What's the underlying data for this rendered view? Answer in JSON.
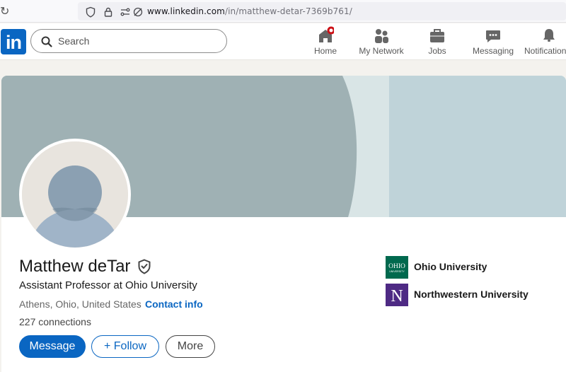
{
  "browser": {
    "url_domain": "www.linkedin.com",
    "url_path": "/in/matthew-detar-7369b761/"
  },
  "nav": {
    "logo": "in",
    "search_placeholder": "Search",
    "items": [
      {
        "label": "Home",
        "icon": "home-icon"
      },
      {
        "label": "My Network",
        "icon": "network-icon"
      },
      {
        "label": "Jobs",
        "icon": "briefcase-icon"
      },
      {
        "label": "Messaging",
        "icon": "chat-icon"
      },
      {
        "label": "Notifications",
        "icon": "bell-icon"
      }
    ]
  },
  "profile": {
    "name": "Matthew deTar",
    "headline": "Assistant Professor at Ohio University",
    "location": "Athens, Ohio, United States",
    "separator": "·",
    "contact_label": "Contact info",
    "connections": "227 connections",
    "actions": {
      "message": "Message",
      "follow": "+ Follow",
      "more": "More"
    },
    "education": [
      {
        "name": "Ohio University",
        "logo_text": "OHIO",
        "logo_subtext": "UNIVERSITY",
        "color": "#00694e"
      },
      {
        "name": "Northwestern University",
        "logo_text": "N",
        "color": "#4e2a84"
      }
    ]
  },
  "colors": {
    "brand": "#0a66c2",
    "banner_dark": "#9fb1b4",
    "banner_mid": "#d9e5e6",
    "banner_light": "#bfd3d9"
  }
}
